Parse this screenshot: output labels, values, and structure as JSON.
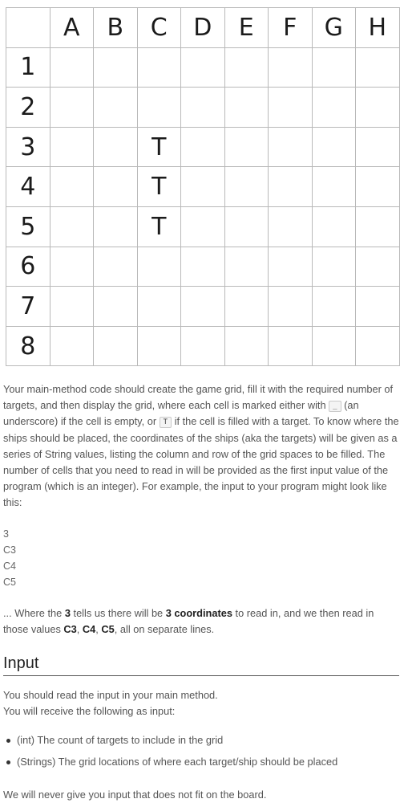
{
  "grid": {
    "columns": [
      "A",
      "B",
      "C",
      "D",
      "E",
      "F",
      "G",
      "H"
    ],
    "rows": [
      {
        "label": "1",
        "cells": [
          "",
          "",
          "",
          "",
          "",
          "",
          "",
          ""
        ]
      },
      {
        "label": "2",
        "cells": [
          "",
          "",
          "",
          "",
          "",
          "",
          "",
          ""
        ]
      },
      {
        "label": "3",
        "cells": [
          "",
          "",
          "T",
          "",
          "",
          "",
          "",
          ""
        ]
      },
      {
        "label": "4",
        "cells": [
          "",
          "",
          "T",
          "",
          "",
          "",
          "",
          ""
        ]
      },
      {
        "label": "5",
        "cells": [
          "",
          "",
          "T",
          "",
          "",
          "",
          "",
          ""
        ]
      },
      {
        "label": "6",
        "cells": [
          "",
          "",
          "",
          "",
          "",
          "",
          "",
          ""
        ]
      },
      {
        "label": "7",
        "cells": [
          "",
          "",
          "",
          "",
          "",
          "",
          "",
          ""
        ]
      },
      {
        "label": "8",
        "cells": [
          "",
          "",
          "",
          "",
          "",
          "",
          "",
          ""
        ]
      }
    ]
  },
  "para1": {
    "t1": "Your main-method code should create the game grid, fill it with the required number of targets, and then display the grid, where each cell is marked either with ",
    "code_empty": "_",
    "t2": " (an underscore) if the cell is empty, or ",
    "code_target": "T",
    "t3": " if the cell is filled with a target. To know where the ships should be placed, the coordinates of the ships (aka the targets) will be given as a series of String values, listing the column and row of the grid spaces to be filled. The number of cells that you need to read in will be provided as the first input value of the program (which is an integer). For example, the input to your program might look like this:"
  },
  "sample_input": [
    "3",
    "C3",
    "C4",
    "C5"
  ],
  "para2": {
    "t1": "... Where the ",
    "b1": "3",
    "t2": " tells us there will be ",
    "b2": "3 coordinates",
    "t3": " to read in, and we then read in those values ",
    "b3": "C3",
    "t4": ", ",
    "b4": "C4",
    "t5": ", ",
    "b5": "C5",
    "t6": ", all on separate lines."
  },
  "input_section": {
    "heading": "Input",
    "line1": "You should read the input in your main method.",
    "line2": "You will receive the following as input:",
    "bullets": [
      "(int) The count of targets to include in the grid",
      "(Strings) The grid locations of where each target/ship should be placed"
    ],
    "footer": "We will never give you input that does not fit on the board."
  }
}
